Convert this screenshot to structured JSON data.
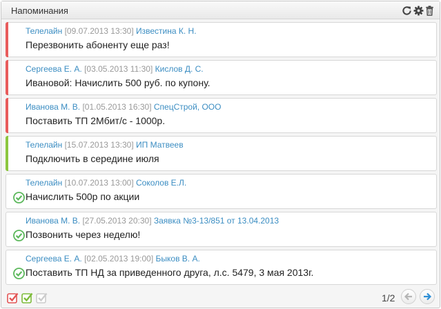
{
  "widget": {
    "title": "Напоминания",
    "header_icons": [
      "refresh-icon",
      "gear-icon",
      "trash-icon"
    ]
  },
  "reminders": [
    {
      "author": "Телелайн",
      "datetime": "[09.07.2013 13:30]",
      "client": "Известина К. Н.",
      "text": "Перезвонить абоненту еще раз!",
      "status": "overdue",
      "bar_color": "#e85c5c"
    },
    {
      "author": "Сергеева Е. А.",
      "datetime": "[03.05.2013 11:30]",
      "client": "Кислов Д. С.",
      "text": "Ивановой: Начислить 500 руб. по купону.",
      "status": "overdue",
      "bar_color": "#e85c5c"
    },
    {
      "author": "Иванова М. В.",
      "datetime": "[01.05.2013 16:30]",
      "client": "СпецСтрой, ООО",
      "text": "Поставить ТП 2Мбит/с - 1000р.",
      "status": "overdue",
      "bar_color": "#e85c5c"
    },
    {
      "author": "Телелайн",
      "datetime": "[15.07.2013 13:30]",
      "client": "ИП Матвеев",
      "text": "Подключить в середине июля",
      "status": "upcoming",
      "bar_color": "#8cc63f"
    },
    {
      "author": "Телелайн",
      "datetime": "[10.07.2013 13:00]",
      "client": "Соколов Е.Л.",
      "text": "Начислить 500р по акции",
      "status": "done",
      "bar_color": ""
    },
    {
      "author": "Иванова М. В.",
      "datetime": "[27.05.2013 20:30]",
      "client": "Заявка №3-13/851 от 13.04.2013",
      "text": "Позвонить через неделю!",
      "status": "done",
      "bar_color": ""
    },
    {
      "author": "Сергеева Е. А.",
      "datetime": "[02.05.2013 19:00]",
      "client": "Быков В. А.",
      "text": "Поставить ТП НД за приведенного друга, л.с. 5479, 3 мая 2013г.",
      "status": "done",
      "bar_color": ""
    }
  ],
  "footer": {
    "filters": [
      {
        "name": "filter-overdue-icon",
        "color": "#e25555"
      },
      {
        "name": "filter-upcoming-icon",
        "color": "#7dbb3a"
      },
      {
        "name": "filter-done-icon",
        "color": "#cccccc"
      }
    ],
    "pager_text": "1/2",
    "prev_icon": "arrow-left-icon",
    "next_icon": "arrow-right-icon"
  },
  "colors": {
    "link": "#3b8dc2",
    "meta": "#999999",
    "check": "#5cb85c",
    "next_arrow": "#2e8fd6",
    "prev_arrow": "#b5b5b5"
  }
}
